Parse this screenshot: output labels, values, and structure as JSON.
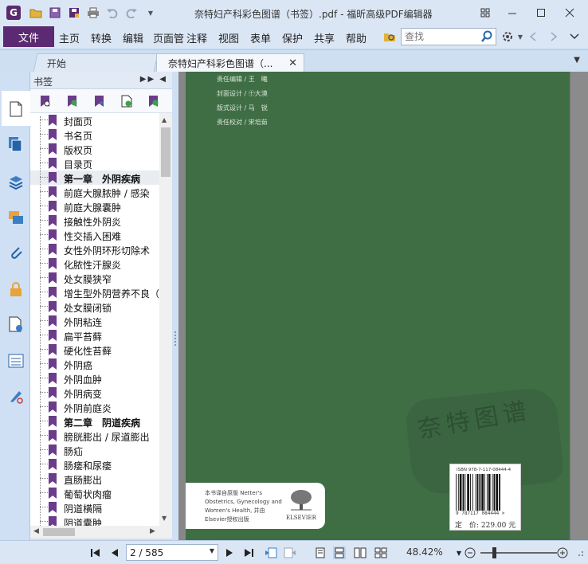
{
  "titlebar": {
    "window_title": "奈特妇产科彩色图谱（书签）.pdf - 福昕高级PDF编辑器",
    "app_logo_glyph": "G",
    "icons": [
      "open-folder-icon",
      "save-icon",
      "save-as-icon",
      "print-icon",
      "undo-icon",
      "redo-icon",
      "customize-icon"
    ],
    "controls": [
      "restore-layout-icon",
      "minimize-icon",
      "maximize-icon",
      "close-icon"
    ]
  },
  "ribbon": {
    "file_label": "文件",
    "tabs": [
      "主页",
      "转换",
      "编辑",
      "页面管",
      "注释",
      "视图",
      "表单",
      "保护",
      "共享",
      "帮助"
    ],
    "search_placeholder": "查找",
    "accent_color": "#5b2a72"
  },
  "doctabs": {
    "start_label": "开始",
    "doc_label": "奈特妇产科彩色图谱（...",
    "close_glyph": "✕"
  },
  "panel": {
    "title": "书签",
    "bookmarks": [
      {
        "label": "封面页",
        "bold": false
      },
      {
        "label": "书名页",
        "bold": false
      },
      {
        "label": "版权页",
        "bold": false
      },
      {
        "label": "目录页",
        "bold": false
      },
      {
        "label": "第一章　外阴疾病",
        "bold": true
      },
      {
        "label": "前庭大腺脓肿 / 感染",
        "bold": false
      },
      {
        "label": "前庭大腺囊肿",
        "bold": false
      },
      {
        "label": "接触性外阴炎",
        "bold": false
      },
      {
        "label": "性交插入困难",
        "bold": false
      },
      {
        "label": "女性外阴环形切除术",
        "bold": false
      },
      {
        "label": "化脓性汗腺炎",
        "bold": false
      },
      {
        "label": "处女膜狭窄",
        "bold": false
      },
      {
        "label": "增生型外阴营养不良（",
        "bold": false
      },
      {
        "label": "处女膜闭锁",
        "bold": false
      },
      {
        "label": "外阴粘连",
        "bold": false
      },
      {
        "label": "扁平苔藓",
        "bold": false
      },
      {
        "label": "硬化性苔藓",
        "bold": false
      },
      {
        "label": "外阴癌",
        "bold": false
      },
      {
        "label": "外阴血肿",
        "bold": false
      },
      {
        "label": "外阴病变",
        "bold": false
      },
      {
        "label": "外阴前庭炎",
        "bold": false
      },
      {
        "label": "第二章　阴道疾病",
        "bold": true
      },
      {
        "label": "膀胱膨出 / 尿道膨出",
        "bold": false
      },
      {
        "label": "肠疝",
        "bold": false
      },
      {
        "label": "肠瘘和尿瘘",
        "bold": false
      },
      {
        "label": "直肠膨出",
        "bold": false
      },
      {
        "label": "葡萄状肉瘤",
        "bold": false
      },
      {
        "label": "阴道横隔",
        "bold": false
      },
      {
        "label": "阴道囊肿",
        "bold": false
      }
    ]
  },
  "page_content": {
    "credits": [
      "责任编辑 / 王　曦",
      "封面设计 / ㊉大漠",
      "版式设计 / 马　锐",
      "责任校对 / 宋培茹"
    ],
    "elsevier_note": "本书译自原版 Netter's Obstetrics, Gynecology and Women's Health, 并由Elsevier授权出版",
    "publisher_logo": "ELSEVIER",
    "isbn_top": "ISBN 978-7-117-08444-4",
    "isbn_number": "9 787117 084444 >",
    "price": "定　价: 229.00 元",
    "page_color": "#3f6e45"
  },
  "statusbar": {
    "page_indicator": "2 / 585",
    "zoom_level": "48.42%",
    "zoom_fraction": 0.18
  }
}
